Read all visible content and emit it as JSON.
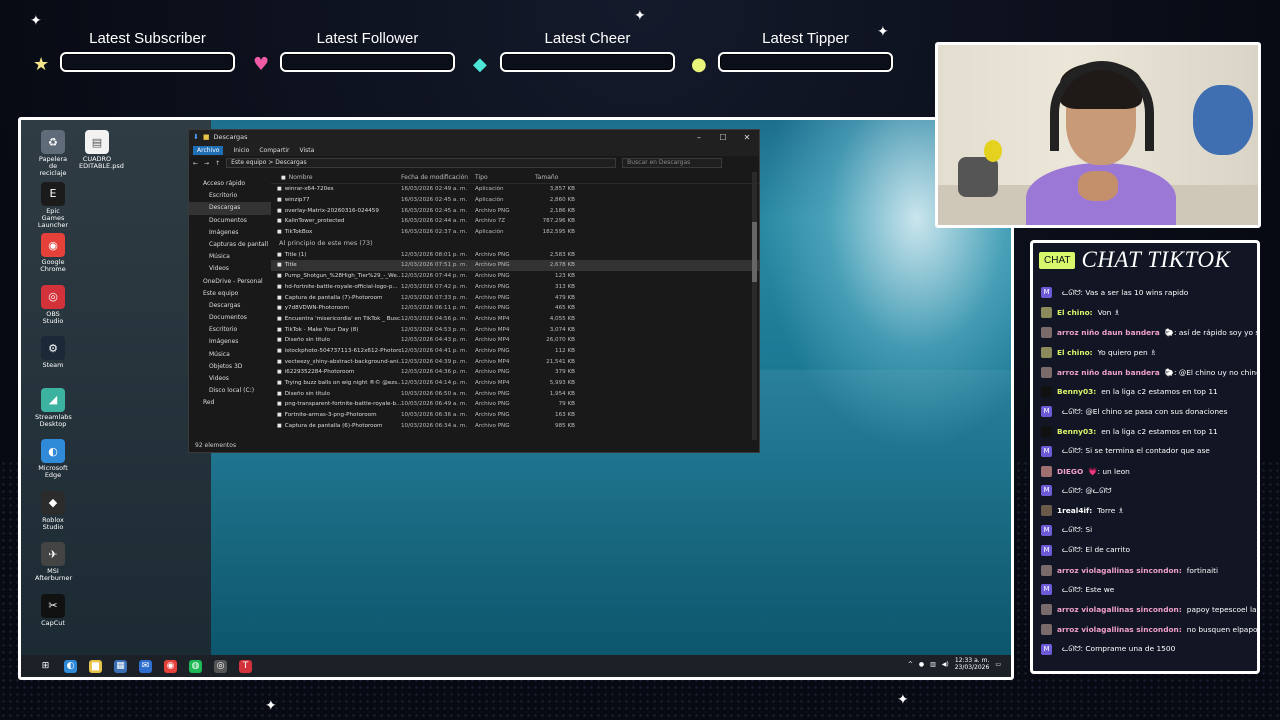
{
  "alerts": [
    {
      "label": "Latest Subscriber",
      "icon": "star-icon",
      "color": "#f5e58a"
    },
    {
      "label": "Latest Follower",
      "icon": "heart-icon",
      "color": "#f05aa6"
    },
    {
      "label": "Latest Cheer",
      "icon": "gem-icon",
      "color": "#4de6d6"
    },
    {
      "label": "Latest Tipper",
      "icon": "coin-icon",
      "color": "#e9f57a"
    }
  ],
  "desktop_icons": [
    {
      "label": "Papelera de reciclaje",
      "icon": "recycle-bin-icon",
      "color": "#5f6b78"
    },
    {
      "label": "Epic Games Launcher",
      "icon": "epic-games-icon",
      "color": "#1b1b1b"
    },
    {
      "label": "Google Chrome",
      "icon": "chrome-icon",
      "color": "#e6403a"
    },
    {
      "label": "OBS Studio",
      "icon": "obs-icon",
      "color": "#d4323a"
    },
    {
      "label": "Steam",
      "icon": "steam-icon",
      "color": "#1b2838"
    },
    {
      "label": "Streamlabs Desktop",
      "icon": "streamlabs-icon",
      "color": "#3bb3a0"
    },
    {
      "label": "Microsoft Edge",
      "icon": "edge-icon",
      "color": "#2f8ad8"
    },
    {
      "label": "Roblox Studio",
      "icon": "roblox-icon",
      "color": "#2b2b2b"
    },
    {
      "label": "MSI Afterburner",
      "icon": "afterburner-icon",
      "color": "#444444"
    },
    {
      "label": "CapCut",
      "icon": "capcut-icon",
      "color": "#111111"
    }
  ],
  "desktop_file": {
    "label": "CUADRO EDITABLE.psd",
    "icon": "file-icon"
  },
  "explorer": {
    "title": "Descargas",
    "ribbon_tabs": [
      "Archivo",
      "Inicio",
      "Compartir",
      "Vista"
    ],
    "address": "Este equipo  >  Descargas",
    "search_placeholder": "Buscar en Descargas",
    "columns": {
      "name": "Nombre",
      "date": "Fecha de modificación",
      "type": "Tipo",
      "size": "Tamaño"
    },
    "nav": [
      "Acceso rápido",
      "Escritorio",
      "Descargas",
      "Documentos",
      "Imágenes",
      "Capturas de pantall",
      "Música",
      "Videos",
      "OneDrive - Personal",
      "Este equipo",
      "Descargas",
      "Documentos",
      "Escritorio",
      "Imágenes",
      "Música",
      "Objetos 3D",
      "Videos",
      "Disco local (C:)",
      "Red"
    ],
    "recent_rows": [
      {
        "name": "winrar-x64-720es",
        "date": "16/03/2026 02:49 a. m.",
        "type": "Aplicación",
        "size": "3,857 KB"
      },
      {
        "name": "winzip77",
        "date": "16/03/2026 02:45 a. m.",
        "type": "Aplicación",
        "size": "2,860 KB"
      },
      {
        "name": "overlay-Matrix-20260316-024459",
        "date": "16/03/2026 02:45 a. m.",
        "type": "Archivo PNG",
        "size": "2,186 KB"
      },
      {
        "name": "KalinTower_protected",
        "date": "16/03/2026 02:44 a. m.",
        "type": "Archivo 7Z",
        "size": "787,296 KB"
      },
      {
        "name": "TikTokBox",
        "date": "16/03/2026 02:37 a. m.",
        "type": "Aplicación",
        "size": "182,595 KB"
      }
    ],
    "group_label": "Al principio de este mes (73)",
    "rows": [
      {
        "name": "Title (1)",
        "date": "12/03/2026 08:01 p. m.",
        "type": "Archivo PNG",
        "size": "2,583 KB"
      },
      {
        "name": "Title",
        "date": "12/03/2026 07:51 p. m.",
        "type": "Archivo PNG",
        "size": "2,678 KB"
      },
      {
        "name": "Pump_Shotgun_%28High_Tier%29_-_We...",
        "date": "12/03/2026 07:44 p. m.",
        "type": "Archivo PNG",
        "size": "123 KB"
      },
      {
        "name": "hd-fortnite-battle-royale-official-logo-p...",
        "date": "12/03/2026 07:42 p. m.",
        "type": "Archivo PNG",
        "size": "313 KB"
      },
      {
        "name": "Captura de pantalla (7)-Photoroom",
        "date": "12/03/2026 07:33 p. m.",
        "type": "Archivo PNG",
        "size": "479 KB"
      },
      {
        "name": "y7d8VDWN-Photoroom",
        "date": "12/03/2026 06:11 p. m.",
        "type": "Archivo PNG",
        "size": "465 KB"
      },
      {
        "name": "Encuentra 'misericordia' en TikTok _ Busc...",
        "date": "12/03/2026 04:56 p. m.",
        "type": "Archivo MP4",
        "size": "4,055 KB"
      },
      {
        "name": "TikTok - Make Your Day (8)",
        "date": "12/03/2026 04:53 p. m.",
        "type": "Archivo MP4",
        "size": "3,074 KB"
      },
      {
        "name": "Diseño sin título",
        "date": "12/03/2026 04:43 p. m.",
        "type": "Archivo MP4",
        "size": "26,070 KB"
      },
      {
        "name": "istockphoto-504737113-612x612-Photoro...",
        "date": "12/03/2026 04:41 p. m.",
        "type": "Archivo PNG",
        "size": "112 KB"
      },
      {
        "name": "vecteezy_shiny-abstract-background-ani...",
        "date": "12/03/2026 04:39 p. m.",
        "type": "Archivo MP4",
        "size": "21,541 KB"
      },
      {
        "name": "i6229352284-Photoroom",
        "date": "12/03/2026 04:36 p. m.",
        "type": "Archivo PNG",
        "size": "379 KB"
      },
      {
        "name": "Trying buzz balls on wig night ®© @ezs...",
        "date": "12/03/2026 04:14 p. m.",
        "type": "Archivo MP4",
        "size": "5,993 KB"
      },
      {
        "name": "Diseño sin título",
        "date": "10/03/2026 06:50 a. m.",
        "type": "Archivo PNG",
        "size": "1,954 KB"
      },
      {
        "name": "png-transparent-fortnite-battle-royale-b...",
        "date": "10/03/2026 06:49 a. m.",
        "type": "Archivo PNG",
        "size": "79 KB"
      },
      {
        "name": "Fortnite-armas-3-png-Photoroom",
        "date": "10/03/2026 06:36 a. m.",
        "type": "Archivo PNG",
        "size": "163 KB"
      },
      {
        "name": "Captura de pantalla (6)-Photoroom",
        "date": "10/03/2026 06:34 a. m.",
        "type": "Archivo PNG",
        "size": "985 KB"
      }
    ],
    "status": "92 elementos"
  },
  "taskbar": {
    "icons": [
      "windows-start-icon",
      "edge-icon",
      "file-explorer-icon",
      "store-icon",
      "mail-icon",
      "chrome-icon",
      "spotify-icon",
      "obs-icon",
      "tiktok-studio-icon"
    ],
    "time": "12:33 a. m.",
    "date": "23/03/2026"
  },
  "chat": {
    "badge": "CHAT",
    "title": "CHAT TIKTOK",
    "messages": [
      {
        "user": "",
        "text": "ᓚᘏᗢ: Vas a ser las 10 wins rapido",
        "avatar": "M",
        "avatar_color": "#6c5ad6",
        "user_color": "#ffffff"
      },
      {
        "user": "El chino:",
        "text": "Von ♗",
        "avatar": "",
        "avatar_color": "#8a8a5a",
        "user_color": "#d9f76a"
      },
      {
        "user": "arroz niño daun bandera",
        "text": "🐑: así de rápido soy yo sin l",
        "avatar": "",
        "avatar_color": "#7a6a6a",
        "user_color": "#f0a0c8"
      },
      {
        "user": "El chino:",
        "text": "Yo quiero pen ♗",
        "avatar": "",
        "avatar_color": "#8a8a5a",
        "user_color": "#d9f76a"
      },
      {
        "user": "arroz niño daun bandera",
        "text": "🐑: @El chino uy no chino",
        "avatar": "",
        "avatar_color": "#7a6a6a",
        "user_color": "#f0a0c8"
      },
      {
        "user": "Benny03:",
        "text": "en la liga c2 estamos en top 11",
        "avatar": "",
        "avatar_color": "#111111",
        "user_color": "#d9f76a"
      },
      {
        "user": "",
        "text": "ᓚᘏᗢ: @El chino se pasa con sus donaciones",
        "avatar": "M",
        "avatar_color": "#6c5ad6",
        "user_color": "#ffffff"
      },
      {
        "user": "Benny03:",
        "text": "en la liga c2 estamos en top 11",
        "avatar": "",
        "avatar_color": "#111111",
        "user_color": "#d9f76a"
      },
      {
        "user": "",
        "text": "ᓚᘏᗢ: Si se termina el contador que ase",
        "avatar": "M",
        "avatar_color": "#6c5ad6",
        "user_color": "#ffffff"
      },
      {
        "user": "DIEGO",
        "text": "💗: un leon",
        "avatar": "",
        "avatar_color": "#a07070",
        "user_color": "#f0a0c8"
      },
      {
        "user": "",
        "text": "ᓚᘏᗢ: @ᓚᘏᗢ",
        "avatar": "M",
        "avatar_color": "#6c5ad6",
        "user_color": "#ffffff"
      },
      {
        "user": "1real4if:",
        "text": "Torre ♗",
        "avatar": "",
        "avatar_color": "#6a5a4a",
        "user_color": "#ffffff"
      },
      {
        "user": "",
        "text": "ᓚᘏᗢ: Si",
        "avatar": "M",
        "avatar_color": "#6c5ad6",
        "user_color": "#ffffff"
      },
      {
        "user": "",
        "text": "ᓚᘏᗢ: El de carrito",
        "avatar": "M",
        "avatar_color": "#6c5ad6",
        "user_color": "#ffffff"
      },
      {
        "user": "arroz violagallinas sincondon:",
        "text": "fortinaiti",
        "avatar": "",
        "avatar_color": "#7a6a6a",
        "user_color": "#f0a0c8"
      },
      {
        "user": "",
        "text": "ᓚᘏᗢ: Este we",
        "avatar": "M",
        "avatar_color": "#6c5ad6",
        "user_color": "#ffffff"
      },
      {
        "user": "arroz violagallinas sincondon:",
        "text": "papoy tepescoel lano",
        "avatar": "",
        "avatar_color": "#7a6a6a",
        "user_color": "#f0a0c8"
      },
      {
        "user": "arroz violagallinas sincondon:",
        "text": "no busquen elpapoyviola",
        "avatar": "",
        "avatar_color": "#7a6a6a",
        "user_color": "#f0a0c8"
      },
      {
        "user": "",
        "text": "ᓚᘏᗢ: Comprame una de 1500",
        "avatar": "M",
        "avatar_color": "#6c5ad6",
        "user_color": "#ffffff"
      }
    ]
  }
}
